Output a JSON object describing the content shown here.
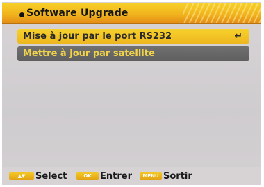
{
  "header": {
    "title": "Software Upgrade"
  },
  "menu": {
    "items": [
      {
        "label": "Mise à jour par le port RS232",
        "selected": true,
        "icon": "enter-icon"
      },
      {
        "label": "Mettre à jour par satellite",
        "selected": false
      }
    ]
  },
  "footer": {
    "hints": [
      {
        "key": "▲▼",
        "label": "Select"
      },
      {
        "key": "OK",
        "label": "Entrer"
      },
      {
        "key": "MENU",
        "label": "Sortir"
      }
    ]
  },
  "colors": {
    "accent": "#f1b41e",
    "highlight_text": "#f0d34a",
    "item_background": "#676767",
    "screen_background": "#d3d0d2"
  }
}
